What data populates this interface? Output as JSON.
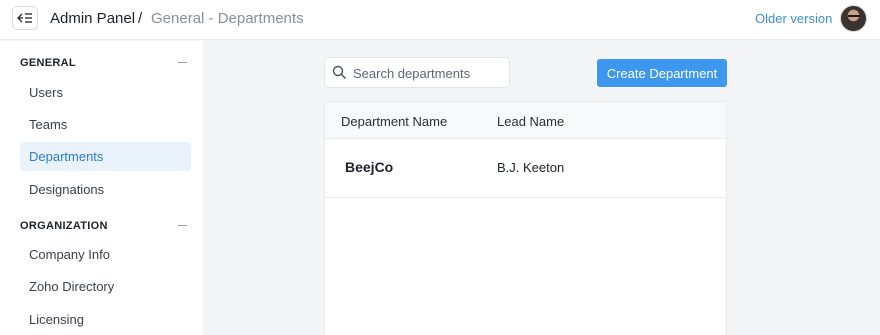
{
  "topbar": {
    "app_title": "Admin Panel",
    "separator": "/",
    "breadcrumb": "General - Departments",
    "older_version_link": "Older version",
    "collapse_icon": "collapse-sidebar-icon",
    "avatar_icon": "user-avatar"
  },
  "sidebar": {
    "sections": [
      {
        "title": "GENERAL",
        "toggle_icon": "minus-icon",
        "items": [
          {
            "label": "Users",
            "active": false
          },
          {
            "label": "Teams",
            "active": false
          },
          {
            "label": "Departments",
            "active": true
          },
          {
            "label": "Designations",
            "active": false
          }
        ]
      },
      {
        "title": "ORGANIZATION",
        "toggle_icon": "minus-icon",
        "items": [
          {
            "label": "Company Info",
            "active": false
          },
          {
            "label": "Zoho Directory",
            "active": false
          },
          {
            "label": "Licensing",
            "active": false
          }
        ]
      }
    ]
  },
  "main": {
    "search": {
      "placeholder": "Search departments",
      "value": "",
      "icon": "search-icon"
    },
    "create_button": "Create Department",
    "table": {
      "columns": [
        "Department Name",
        "Lead Name"
      ],
      "rows": [
        {
          "department": "BeejCo",
          "lead": "B.J. Keeton"
        }
      ]
    }
  },
  "colors": {
    "accent": "#3d97ee",
    "link": "#3a8fd8",
    "active_bg": "#eaf2fb",
    "active_text": "#2e7bd0",
    "page_bg": "#f4f5f7"
  }
}
